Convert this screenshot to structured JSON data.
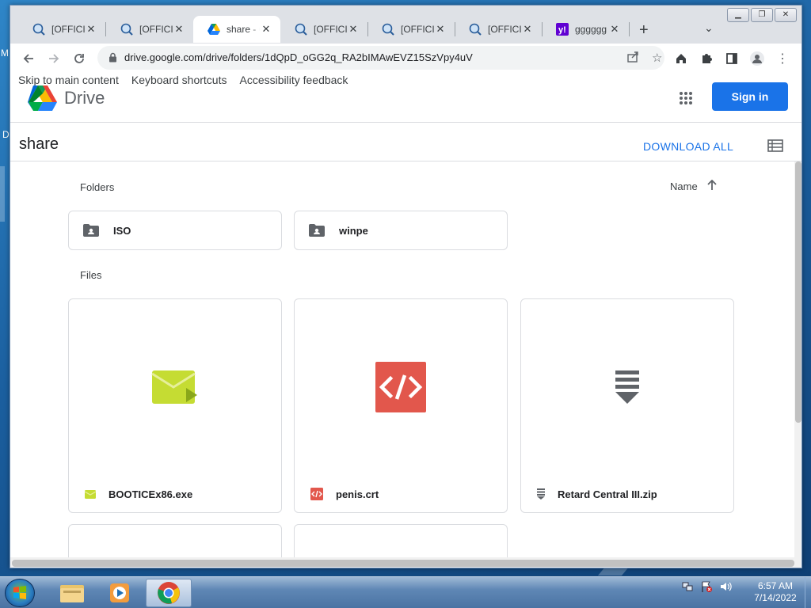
{
  "desktop": {
    "edge_text_1": "M",
    "edge_text_2": "D"
  },
  "browser": {
    "tabs": [
      {
        "title": "[OFFICIA",
        "icon": "magnifier-globe-icon",
        "active": false
      },
      {
        "title": "[OFFICIA",
        "icon": "magnifier-globe-icon",
        "active": false
      },
      {
        "title": "share - G",
        "icon": "google-drive-icon",
        "active": true
      },
      {
        "title": "[OFFICIA",
        "icon": "magnifier-globe-icon",
        "active": false
      },
      {
        "title": "[OFFICIA",
        "icon": "magnifier-globe-icon",
        "active": false
      },
      {
        "title": "[OFFICIA",
        "icon": "magnifier-globe-icon",
        "active": false
      },
      {
        "title": "gggggg",
        "icon": "yahoo-icon",
        "active": false
      }
    ],
    "close_glyph": "✕",
    "new_tab_glyph": "+",
    "url": "drive.google.com/drive/folders/1dQpD_oGG2q_RA2bIMAwEVZ15SzVpy4uV"
  },
  "drive": {
    "skip_links": [
      "Skip to main content",
      "Keyboard shortcuts",
      "Accessibility feedback"
    ],
    "product_name": "Drive",
    "sign_in": "Sign in",
    "folder_name": "share",
    "download_all": "DOWNLOAD ALL",
    "folders_label": "Folders",
    "files_label": "Files",
    "sort_label": "Name",
    "folders": [
      {
        "name": "ISO"
      },
      {
        "name": "winpe"
      }
    ],
    "files": [
      {
        "name": "BOOTICEx86.exe",
        "icon": "exe-envelope-icon",
        "color": "#c5dc33"
      },
      {
        "name": "penis.crt",
        "icon": "code-icon",
        "color": "#e2574c"
      },
      {
        "name": "Retard Central III.zip",
        "icon": "zip-icon",
        "color": "#5f6368"
      }
    ]
  },
  "taskbar": {
    "time": "6:57 AM",
    "date": "7/14/2022"
  },
  "colors": {
    "accent": "#1a73e8",
    "border": "#dadce0"
  }
}
